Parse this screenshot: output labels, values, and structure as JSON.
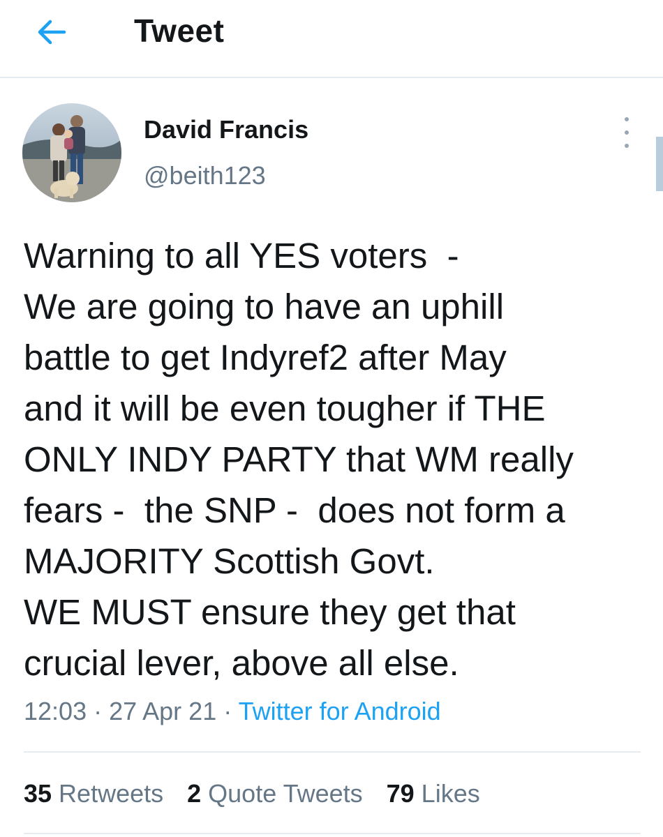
{
  "header": {
    "title": "Tweet",
    "back_icon": "arrow-left-icon",
    "accent_color": "#1da1f2"
  },
  "author": {
    "name": "David Francis",
    "handle": "@beith123",
    "more_icon": "vertical-ellipsis-icon"
  },
  "tweet": {
    "lines": [
      "Warning to all YES voters  -",
      "We are going to have an uphill",
      "battle to get Indyref2 after May",
      "and it will be even tougher if THE",
      "ONLY INDY PARTY that WM really",
      "fears -  the SNP -  does not form a",
      "MAJORITY Scottish Govt.",
      "WE MUST ensure they get that",
      "crucial lever, above all else."
    ],
    "time": "12:03",
    "date": "27 Apr 21",
    "source": "Twitter for Android"
  },
  "stats": {
    "retweets_count": "35",
    "retweets_label": "Retweets",
    "quotes_count": "2",
    "quotes_label": "Quote Tweets",
    "likes_count": "79",
    "likes_label": "Likes"
  }
}
